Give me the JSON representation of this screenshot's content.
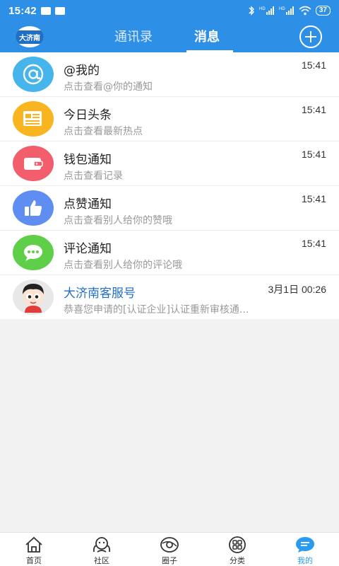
{
  "status": {
    "time": "15:42",
    "battery": "37",
    "signal_labels": [
      "HD",
      "HD"
    ]
  },
  "header": {
    "logo_text": "大济南",
    "tabs": [
      {
        "label": "通讯录",
        "active": false
      },
      {
        "label": "消息",
        "active": true
      }
    ]
  },
  "messages": [
    {
      "title": "@我的",
      "subtitle": "点击查看@你的通知",
      "time": "15:41",
      "icon": "at-icon",
      "color": "#45b5ec"
    },
    {
      "title": "今日头条",
      "subtitle": "点击查看最新热点",
      "time": "15:41",
      "icon": "newspaper-icon",
      "color": "#f9b51f"
    },
    {
      "title": "钱包通知",
      "subtitle": "点击查看记录",
      "time": "15:41",
      "icon": "wallet-icon",
      "color": "#f25e6b"
    },
    {
      "title": "点赞通知",
      "subtitle": "点击查看别人给你的赞哦",
      "time": "15:41",
      "icon": "thumbs-up-icon",
      "color": "#5f8df2"
    },
    {
      "title": "评论通知",
      "subtitle": "点击查看别人给你的评论哦",
      "time": "15:41",
      "icon": "comment-icon",
      "color": "#5fce48"
    },
    {
      "title": "大济南客服号",
      "subtitle": "恭喜您申请的[认证企业]认证重新审核通...",
      "time": "3月1日 00:26",
      "icon": "avatar",
      "color": "#e8e8e8"
    }
  ],
  "nav": [
    {
      "label": "首页",
      "icon": "home-icon",
      "active": false
    },
    {
      "label": "社区",
      "icon": "community-icon",
      "active": false
    },
    {
      "label": "圈子",
      "icon": "circle-icon",
      "active": false
    },
    {
      "label": "分类",
      "icon": "category-icon",
      "active": false
    },
    {
      "label": "我的",
      "icon": "chat-bubble-icon",
      "active": true
    }
  ]
}
